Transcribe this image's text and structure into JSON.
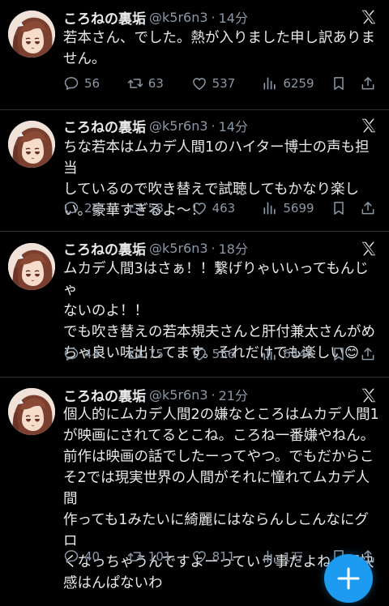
{
  "tweets": [
    {
      "name": "ころねの裏垢",
      "handle": "@k5r6n3",
      "sep": "·",
      "time": "14分",
      "text": "若本さん、でした。熱が入りました申し訳ありま\nせん。",
      "replies": "56",
      "retweets": "63",
      "likes": "537",
      "views": "6259"
    },
    {
      "name": "ころねの裏垢",
      "handle": "@k5r6n3",
      "sep": "·",
      "time": "14分",
      "text": "ちな若本はムカデ人間1のハイター博士の声も担当\nしているので吹き替えで試聴してもかなり楽し\nい。豪華すぎるよ〜！",
      "replies": "26",
      "retweets": "58",
      "likes": "463",
      "views": "5699"
    },
    {
      "name": "ころねの裏垢",
      "handle": "@k5r6n3",
      "sep": "·",
      "time": "18分",
      "text": "ムカデ人間3はさぁ！！繋げりゃいいってもんじゃ\nないのよ！！\nでも吹き替えの若本規夫さんと肝付兼太さんがめ\nちゃ良い味出してます。それだけでも楽しい😊",
      "replies": "44",
      "retweets": "75",
      "likes": "556",
      "views": "6446"
    },
    {
      "name": "ころねの裏垢",
      "handle": "@k5r6n3",
      "sep": "·",
      "time": "21分",
      "text": "個人的にムカデ人間2の嫌なところはムカデ人間1\nが映画にされてるとこね。ころね一番嫌やねん。\n前作は映画の話でしたーってやつ。でもだからこ\nそ2では現実世界の人間がそれに憧れてムカデ人間\n作っても1みたいに綺麗にはならんしこんなにグロ\nくなっちゃうんですよーっていう事だよね。不快\n感はんぱないわ",
      "replies": "40",
      "retweets": "101",
      "likes": "811",
      "views": "1万"
    }
  ],
  "colors": {
    "background": "#000000",
    "text": "#e7e9ea",
    "muted": "#8b98a5",
    "fab": "#1d9bf0"
  },
  "icons": [
    "reply-icon",
    "retweet-icon",
    "like-icon",
    "views-icon",
    "bookmark-icon",
    "share-icon",
    "x-logo-icon",
    "compose-icon"
  ]
}
